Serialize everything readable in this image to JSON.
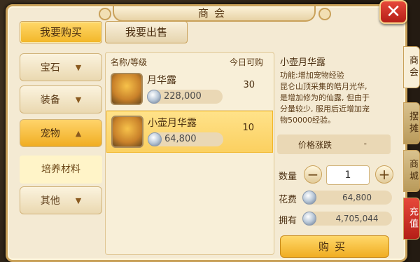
{
  "window": {
    "title": "商会",
    "close_icon": "close-icon"
  },
  "top_tabs": [
    {
      "label": "我要购买",
      "active": true
    },
    {
      "label": "我要出售",
      "active": false
    }
  ],
  "categories": [
    {
      "label": "宝石"
    },
    {
      "label": "装备"
    },
    {
      "label": "宠物",
      "active": true
    },
    {
      "label": "其他"
    }
  ],
  "subcategory": {
    "label": "培养材料"
  },
  "list": {
    "header_name": "名称/等级",
    "header_qty": "今日可购",
    "items": [
      {
        "name": "月华露",
        "price": "228,000",
        "qty": "30",
        "selected": false
      },
      {
        "name": "小壶月华露",
        "price": "64,800",
        "qty": "10",
        "selected": true
      }
    ]
  },
  "detail": {
    "title": "小壶月华露",
    "desc_lines": [
      "功能:增加宠物经验",
      "昆仑山顶采集的皓月光华,",
      "是增加修为的仙露, 但由于",
      "分量较少, 服用后近增加宠",
      "物50000经验。"
    ],
    "trend_label": "价格涨跌",
    "trend_value": "-",
    "qty_label": "数量",
    "qty_value": "1",
    "cost_label": "花费",
    "cost_value": "64,800",
    "own_label": "拥有",
    "own_value": "4,705,044",
    "buy_label": "购买"
  },
  "side_tabs": [
    {
      "label": "商会",
      "active": true
    },
    {
      "label": "摆摊"
    },
    {
      "label": "商城"
    },
    {
      "label": "充值"
    }
  ],
  "colors": {
    "accent": "#f2b628",
    "panel": "#f4ead3",
    "close": "#c8281e"
  }
}
